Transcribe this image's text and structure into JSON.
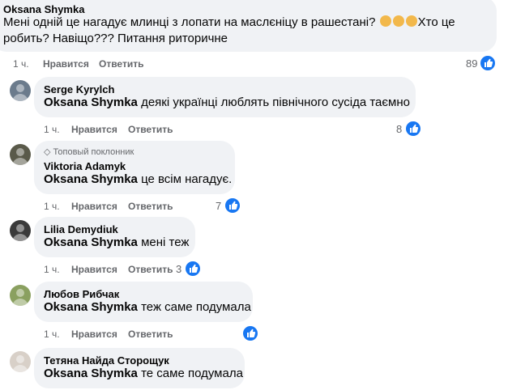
{
  "colors": {
    "bubble": "#f0f2f5",
    "like_blue": "#1877f2",
    "meta_gray": "#65676b"
  },
  "main_comment": {
    "author": "Oksana Shymka",
    "text_line1": "Мені одній це нагадує млинці з лопати на маслєніцу в рашестані?",
    "emojis": [
      "face-emoji",
      "face-emoji",
      "face-emoji"
    ],
    "text_after_emoji": "Хто це",
    "text_line2": "робить? Навіщо??? Питання риторичне",
    "time": "1 ч.",
    "like": "Нравится",
    "reply": "Ответить",
    "reactions": "89"
  },
  "replies": [
    {
      "author": "Serge Kyrylch",
      "mention": "Oksana Shymka",
      "text": "деякі українці люблять північного сусіда таємно",
      "time": "1 ч.",
      "like": "Нравится",
      "reply": "Ответить",
      "reactions": "8",
      "badge": ""
    },
    {
      "author": "Viktoria Adamyk",
      "mention": "Oksana Shymka",
      "text": "це всім нагадує.",
      "time": "1 ч.",
      "like": "Нравится",
      "reply": "Ответить",
      "reactions": "7",
      "badge": "Топовый поклонник"
    },
    {
      "author": "Lilia Demydiuk",
      "mention": "Oksana Shymka",
      "text": "мені теж",
      "time": "1 ч.",
      "like": "Нравится",
      "reply": "Ответить",
      "reactions": "3",
      "badge": ""
    },
    {
      "author": "Любов Рибчак",
      "mention": "Oksana Shymka",
      "text": "теж саме подумала",
      "time": "1 ч.",
      "like": "Нравится",
      "reply": "Ответить",
      "reactions": "",
      "badge": ""
    },
    {
      "author": "Тетяна Найда Сторощук",
      "mention": "Oksana Shymka",
      "text": "те саме подумала",
      "time": "",
      "like": "",
      "reply": "",
      "reactions": "",
      "badge": ""
    }
  ]
}
